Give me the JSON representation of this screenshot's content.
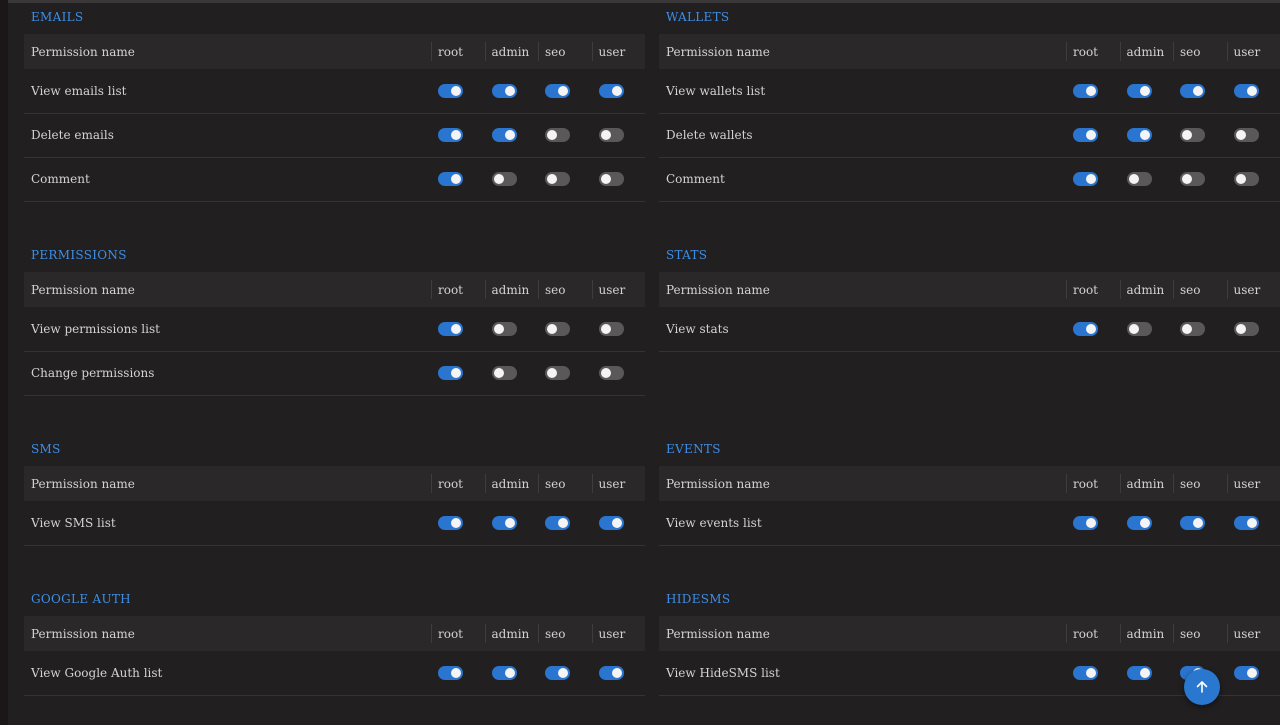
{
  "columns": {
    "name": "Permission name",
    "roles": [
      "root",
      "admin",
      "seo",
      "user"
    ]
  },
  "sections": {
    "emails": {
      "title": "EMAILS",
      "rows": [
        {
          "name": "View emails list",
          "perms": [
            true,
            true,
            true,
            true
          ]
        },
        {
          "name": "Delete emails",
          "perms": [
            true,
            true,
            false,
            false
          ]
        },
        {
          "name": "Comment",
          "perms": [
            true,
            false,
            false,
            false
          ]
        }
      ]
    },
    "wallets": {
      "title": "WALLETS",
      "rows": [
        {
          "name": "View wallets list",
          "perms": [
            true,
            true,
            true,
            true
          ]
        },
        {
          "name": "Delete wallets",
          "perms": [
            true,
            true,
            false,
            false
          ]
        },
        {
          "name": "Comment",
          "perms": [
            true,
            false,
            false,
            false
          ]
        }
      ]
    },
    "permissions": {
      "title": "PERMISSIONS",
      "rows": [
        {
          "name": "View permissions list",
          "perms": [
            true,
            false,
            false,
            false
          ]
        },
        {
          "name": "Change permissions",
          "perms": [
            true,
            false,
            false,
            false
          ]
        }
      ]
    },
    "stats": {
      "title": "STATS",
      "rows": [
        {
          "name": "View stats",
          "perms": [
            true,
            false,
            false,
            false
          ]
        }
      ]
    },
    "sms": {
      "title": "SMS",
      "rows": [
        {
          "name": "View SMS list",
          "perms": [
            true,
            true,
            true,
            true
          ]
        }
      ]
    },
    "events": {
      "title": "EVENTS",
      "rows": [
        {
          "name": "View events list",
          "perms": [
            true,
            true,
            true,
            true
          ]
        }
      ]
    },
    "google_auth": {
      "title": "GOOGLE AUTH",
      "rows": [
        {
          "name": "View Google Auth list",
          "perms": [
            true,
            true,
            true,
            true
          ]
        }
      ]
    },
    "hidesms": {
      "title": "HIDESMS",
      "rows": [
        {
          "name": "View HideSMS list",
          "perms": [
            true,
            true,
            true,
            true
          ]
        }
      ]
    }
  },
  "scroll_top_button": {
    "icon": "arrow-up-icon"
  },
  "colors": {
    "accent": "#2a75cf",
    "title": "#3d8ee6",
    "background": "#221f20",
    "header_row": "#2b2829",
    "toggle_off": "#5b5859"
  }
}
